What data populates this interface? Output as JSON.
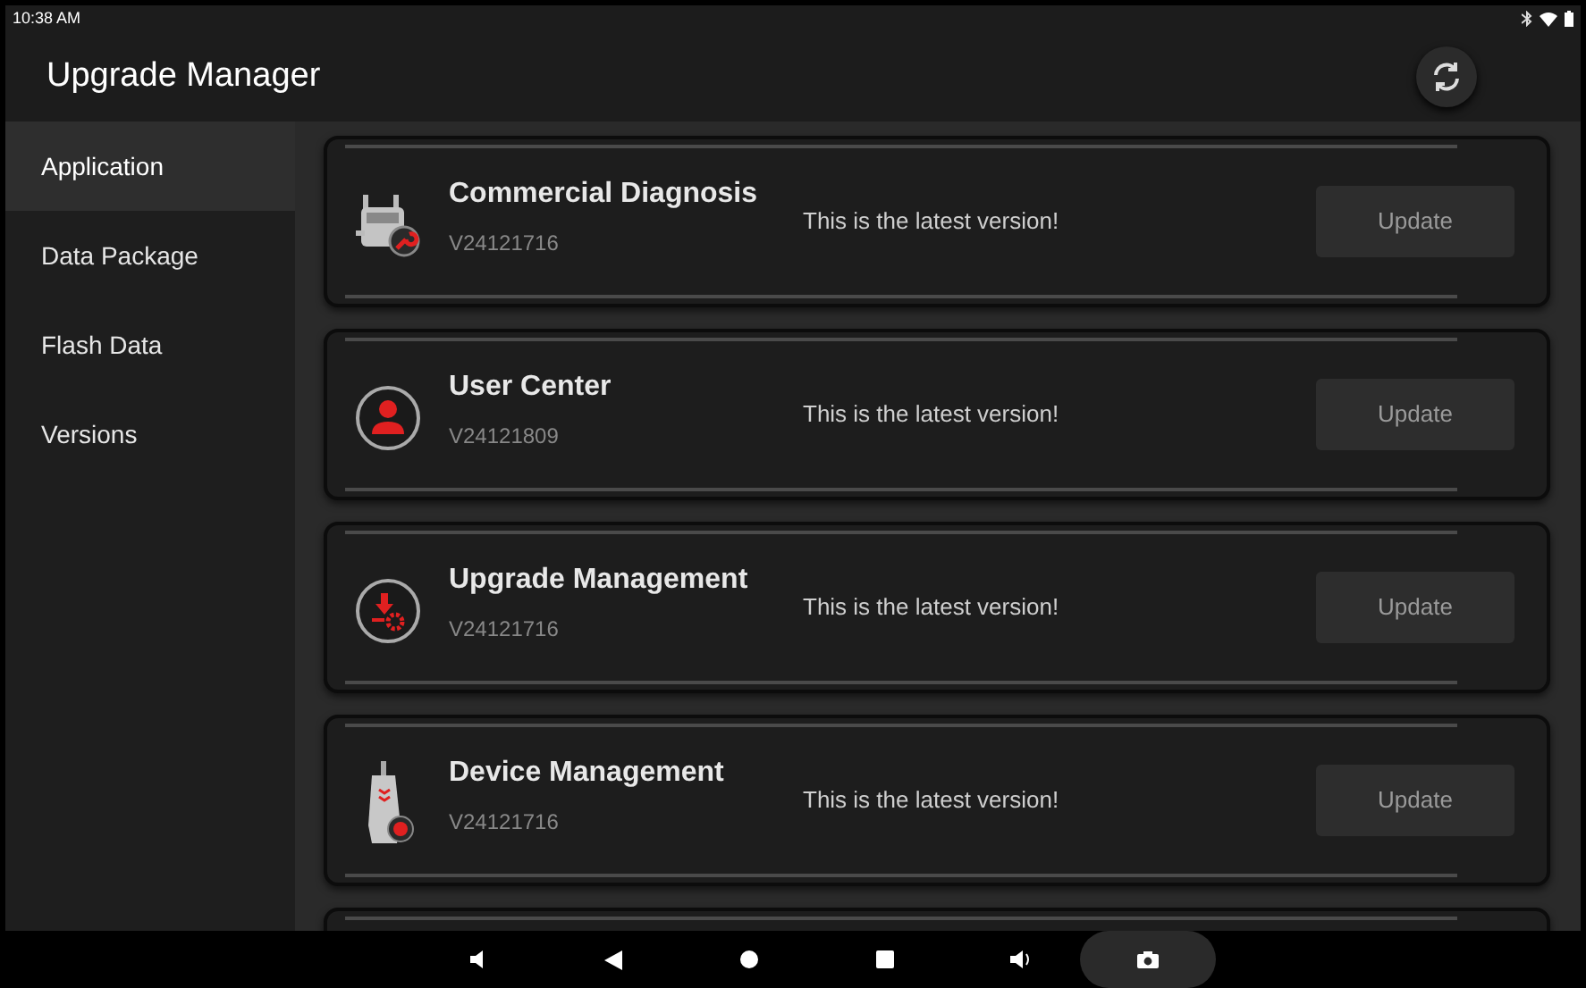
{
  "status_bar": {
    "time": "10:38 AM"
  },
  "header": {
    "title": "Upgrade Manager"
  },
  "sidebar": {
    "items": [
      {
        "label": "Application",
        "selected": true
      },
      {
        "label": "Data Package",
        "selected": false
      },
      {
        "label": "Flash Data",
        "selected": false
      },
      {
        "label": "Versions",
        "selected": false
      }
    ]
  },
  "apps": [
    {
      "kind": "truck",
      "name": "Commercial Diagnosis",
      "version": "V24121716",
      "status": "This is the latest version!",
      "button": "Update",
      "disabled": true
    },
    {
      "kind": "user",
      "name": "User Center",
      "version": "V24121809",
      "status": "This is the latest version!",
      "button": "Update",
      "disabled": true
    },
    {
      "kind": "download",
      "name": "Upgrade Management",
      "version": "V24121716",
      "status": "This is the latest version!",
      "button": "Update",
      "disabled": true
    },
    {
      "kind": "device",
      "name": "Device Management",
      "version": "V24121716",
      "status": "This is the latest version!",
      "button": "Update",
      "disabled": true
    }
  ]
}
